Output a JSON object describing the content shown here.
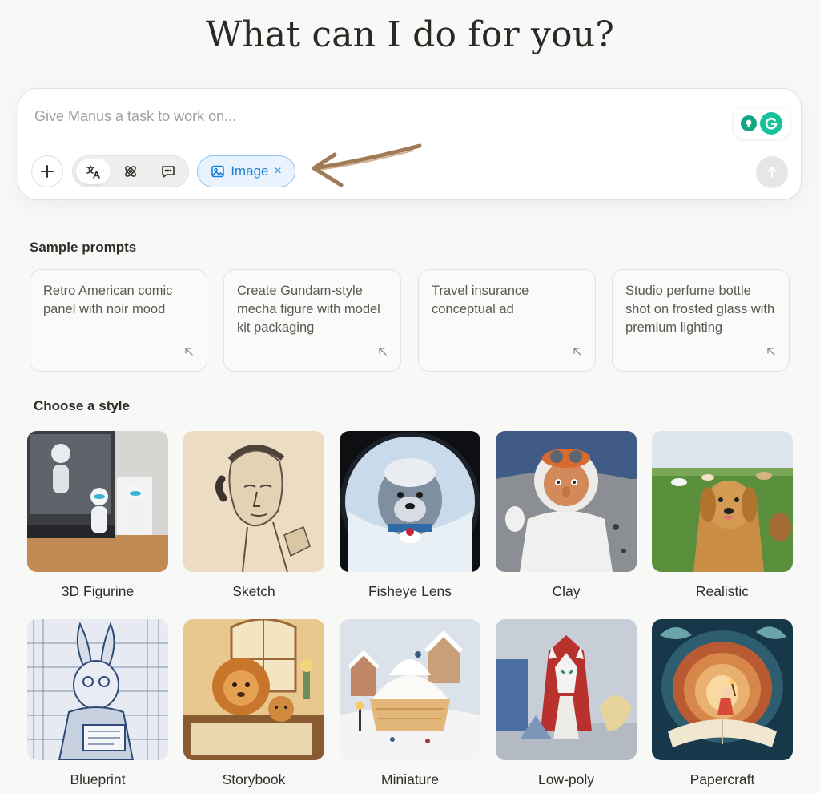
{
  "header": {
    "title": "What can I do for you?"
  },
  "composer": {
    "placeholder": "Give Manus a task to work on...",
    "image_chip_label": "Image",
    "image_chip_close": "×"
  },
  "sample_prompts": {
    "title": "Sample prompts",
    "items": [
      {
        "text": "Retro American comic panel with noir mood"
      },
      {
        "text": "Create Gundam-style mecha figure with model kit packaging"
      },
      {
        "text": "Travel insurance conceptual ad"
      },
      {
        "text": "Studio perfume bottle shot on frosted glass with premium lighting"
      }
    ]
  },
  "styles": {
    "title": "Choose a style",
    "items": [
      {
        "label": "3D Figurine"
      },
      {
        "label": "Sketch"
      },
      {
        "label": "Fisheye Lens"
      },
      {
        "label": "Clay"
      },
      {
        "label": "Realistic"
      },
      {
        "label": "Blueprint"
      },
      {
        "label": "Storybook"
      },
      {
        "label": "Miniature"
      },
      {
        "label": "Low-poly"
      },
      {
        "label": "Papercraft"
      }
    ]
  },
  "colors": {
    "accent_blue": "#1a81d9",
    "annotation_brown": "#a07a55",
    "grammarly_green": "#15c39a"
  }
}
